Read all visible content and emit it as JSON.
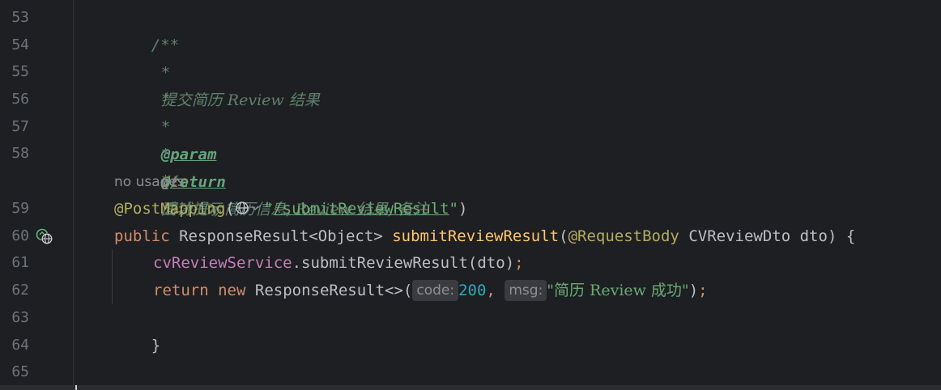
{
  "editor": {
    "line_numbers": [
      "53",
      "54",
      "55",
      "56",
      "57",
      "58",
      "59",
      "60",
      "61",
      "62",
      "63",
      "64",
      "65"
    ],
    "doc": {
      "open": "/**",
      "star": "*",
      "desc_text": "提交简历 Review 结果",
      "param_tag": "@param",
      "param_name": "dto",
      "param_desc": "面试 ID, 简历信息, Review 结果, 备注",
      "return_tag": "@return",
      "return_desc": "成功提示",
      "close": "*/"
    },
    "usages": "no usages",
    "annotation": {
      "name": "@PostMapping",
      "open_paren": "(",
      "quote_open": "\"",
      "path": "/submitReviewResult",
      "quote_close": "\"",
      "close_paren": ")"
    },
    "signature": {
      "modifier": "public",
      "return_type": "ResponseResult<Object>",
      "method": "submitReviewResult",
      "open_paren": "(",
      "param_annotation": "@RequestBody",
      "param_type": "CVReviewDto",
      "param_name": "dto",
      "close": ") {"
    },
    "body_line1": {
      "field": "cvReviewService",
      "call": ".submitReviewResult(dto)",
      "semi": ";"
    },
    "body_line2": {
      "kw_return": "return",
      "kw_new": "new",
      "type": "ResponseResult<>(",
      "hint_code": "code:",
      "code_value": "200",
      "comma": ",",
      "hint_msg": "msg:",
      "msg_value": "\"简历 Review 成功\"",
      "close": ")",
      "semi": ";"
    },
    "method_close": "}",
    "class_close": "}"
  }
}
